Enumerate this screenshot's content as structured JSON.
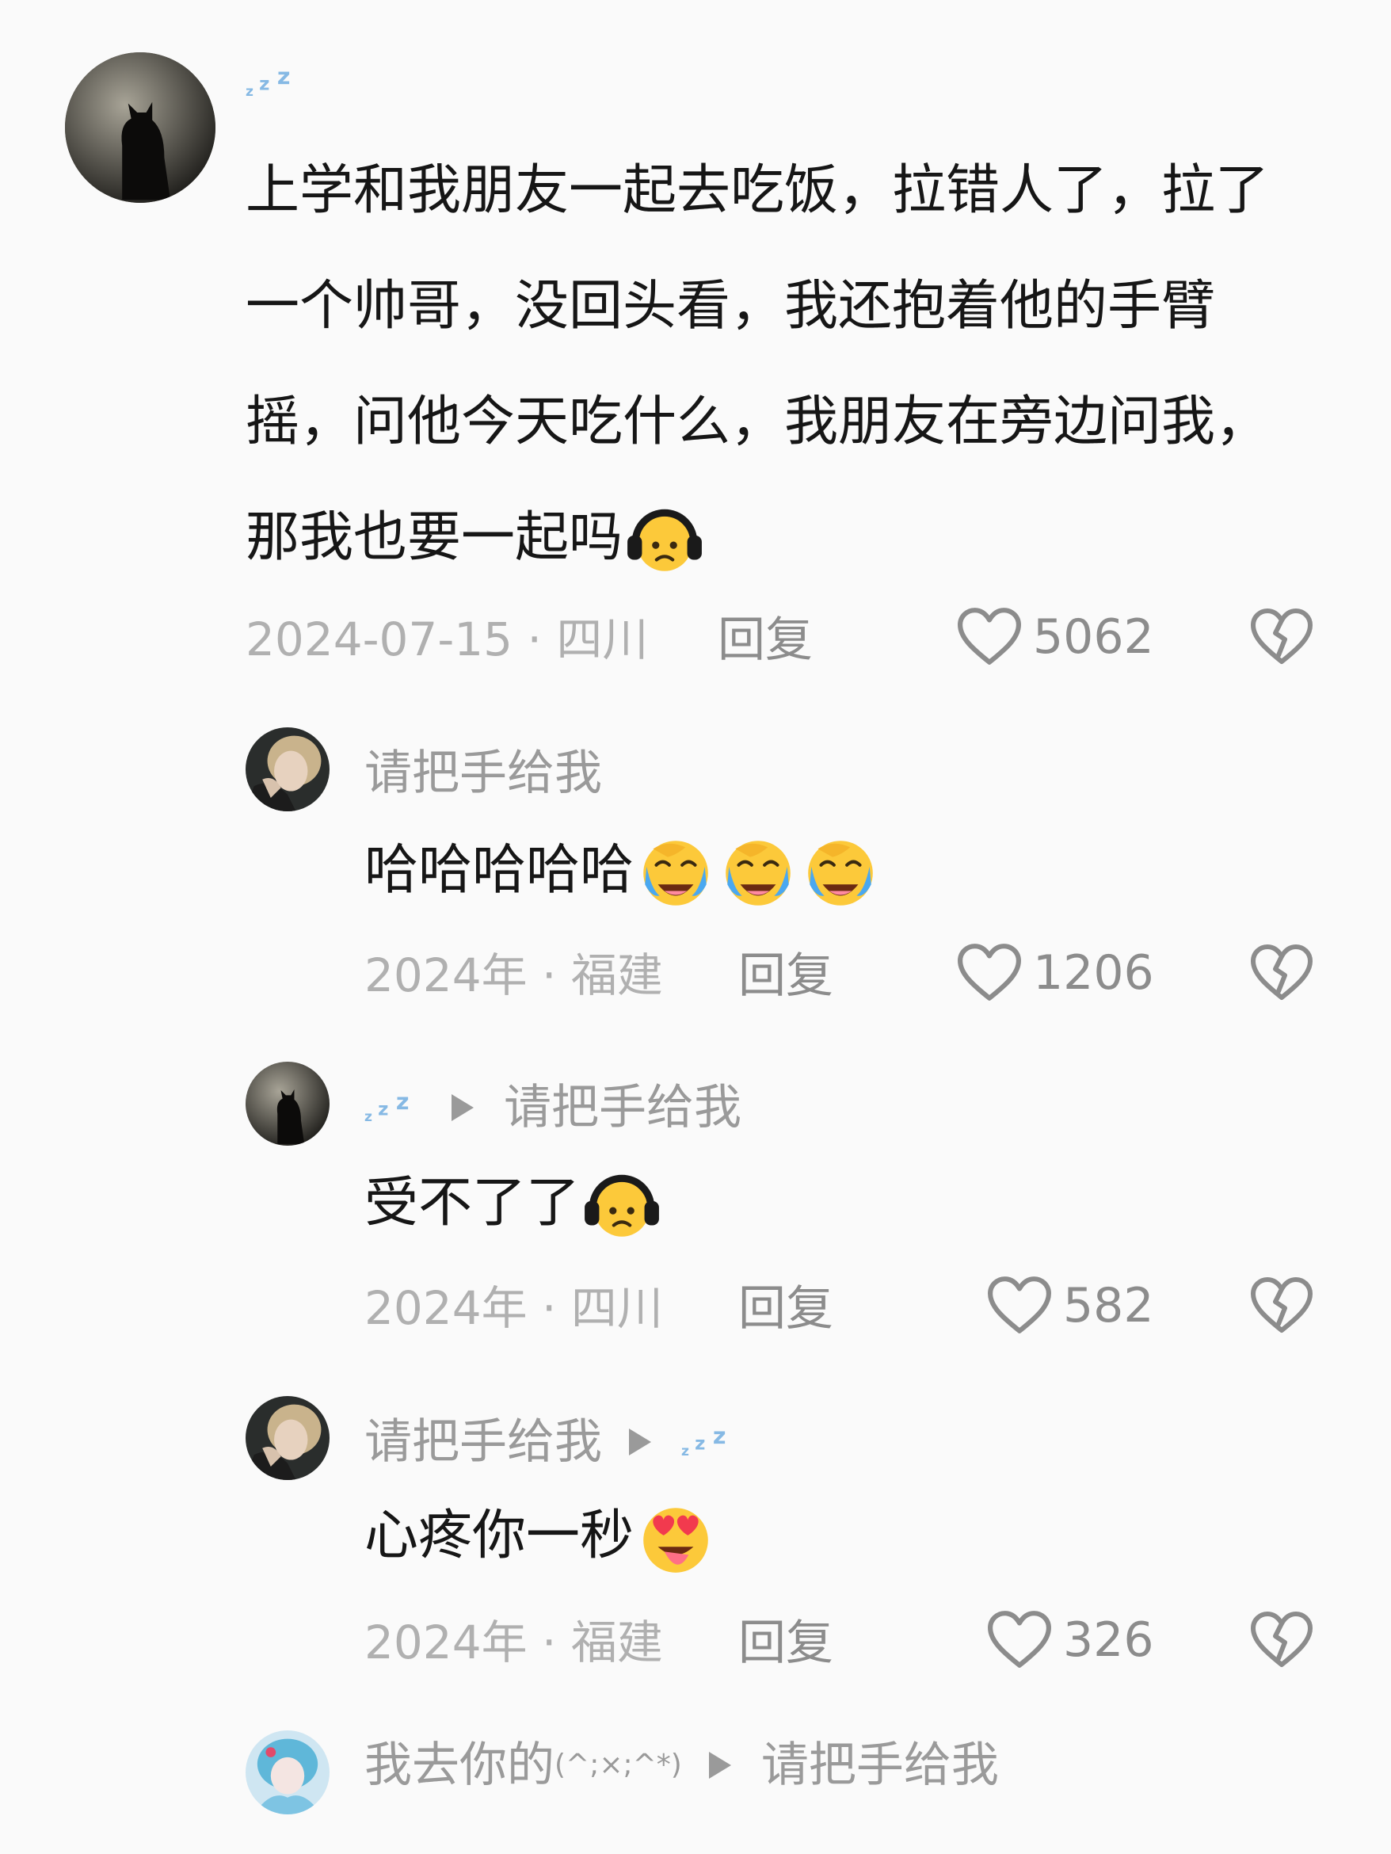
{
  "comments": [
    {
      "author_icon": "zzz-icon",
      "text": "上学和我朋友一起去吃饭，拉错人了，拉了一个帅哥，没回头看，我还抱着他的手臂摇，问他今天吃什么，我朋友在旁边问我，那我也要一起吗",
      "text_emoji": "headphone-face-emoji",
      "date": "2024-07-15",
      "location": "四川",
      "reply_label": "回复",
      "likes": "5062"
    },
    {
      "author": "请把手给我",
      "text": "哈哈哈哈哈",
      "text_emoji": "rofl-emoji",
      "date": "2024年",
      "location": "福建",
      "reply_label": "回复",
      "likes": "1206"
    },
    {
      "author_icon": "zzz-icon",
      "reply_to": "请把手给我",
      "text": "受不了了",
      "text_emoji": "headphone-face-emoji",
      "date": "2024年",
      "location": "四川",
      "reply_label": "回复",
      "likes": "582"
    },
    {
      "author": "请把手给我",
      "reply_to_icon": "zzz-icon",
      "text": "心疼你一秒",
      "text_emoji": "heart-eyes-tongue-emoji",
      "date": "2024年",
      "location": "福建",
      "reply_label": "回复",
      "likes": "326"
    },
    {
      "author": "我去你的",
      "author_suffix": "(^;×;^*)",
      "reply_to": "请把手给我"
    }
  ],
  "separator": "·",
  "colors": {
    "text": "#161616",
    "muted": "#9a9a9a",
    "zzz": "#86b9e4"
  }
}
